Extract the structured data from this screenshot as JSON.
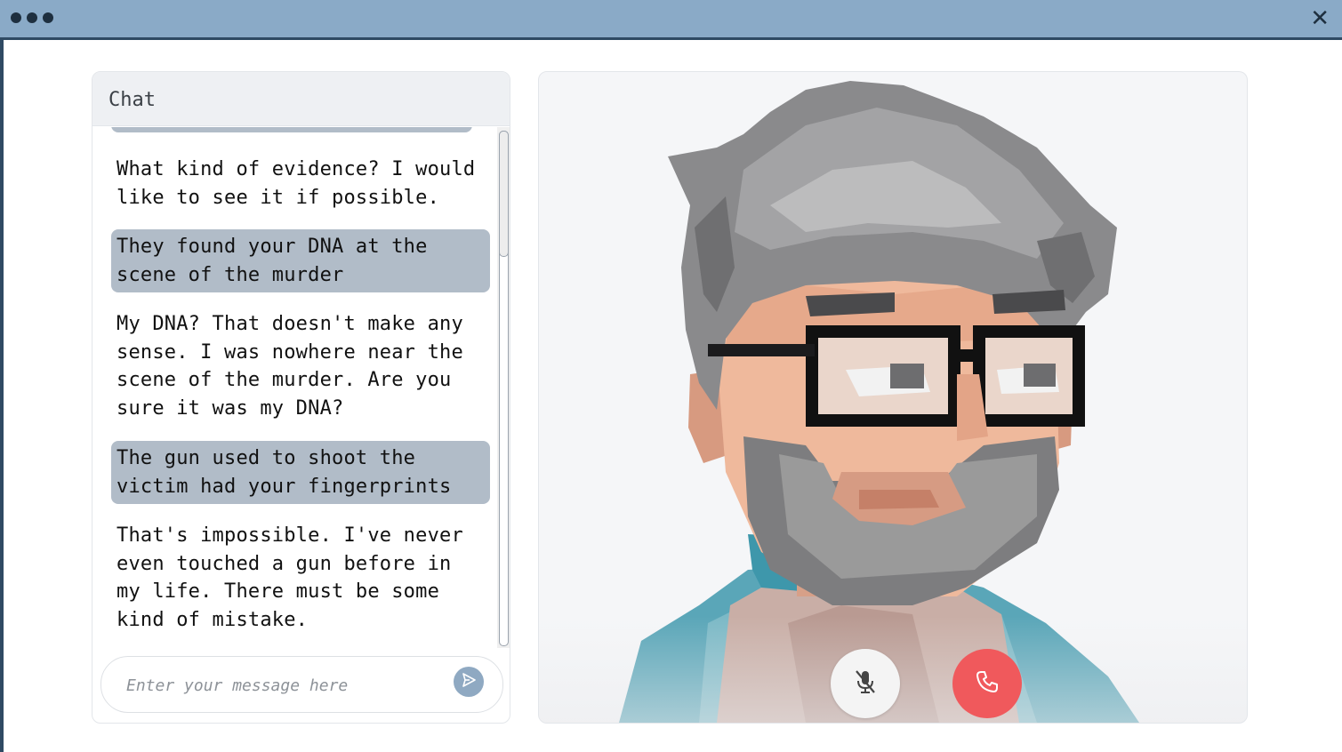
{
  "window": {
    "menu_icon": "three-dots-icon",
    "close_label": "✕"
  },
  "chat": {
    "title": "Chat",
    "messages": [
      {
        "role": "ai",
        "text": "What kind of evidence? I would like to see it if possible."
      },
      {
        "role": "user",
        "text": "They found your DNA at the scene of the murder"
      },
      {
        "role": "ai",
        "text": "My DNA? That doesn't make any sense. I was nowhere near the scene of the murder. Are you sure it was my DNA?"
      },
      {
        "role": "user",
        "text": "The gun used to shoot the victim had your fingerprints"
      },
      {
        "role": "ai",
        "text": "That's impossible. I've never even touched a gun before in my life. There must be some kind of mistake."
      }
    ],
    "input": {
      "placeholder": "Enter your message here",
      "value": ""
    },
    "send_icon": "send-icon"
  },
  "call": {
    "mute_icon": "microphone-muted-icon",
    "hangup_icon": "phone-icon",
    "colors": {
      "hangup": "#f0595c",
      "accent": "#8aaac7",
      "user_bubble": "#b1bcc8"
    }
  }
}
